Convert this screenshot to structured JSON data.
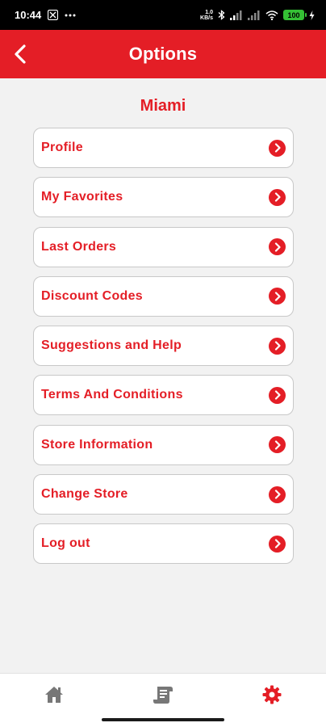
{
  "status_bar": {
    "time": "10:44",
    "net_speed_value": "1.0",
    "net_speed_unit": "KB/s",
    "battery_level": "100"
  },
  "header": {
    "title": "Options"
  },
  "store": {
    "name": "Miami"
  },
  "menu": {
    "items": [
      {
        "label": "Profile"
      },
      {
        "label": "My Favorites"
      },
      {
        "label": "Last Orders"
      },
      {
        "label": "Discount Codes"
      },
      {
        "label": "Suggestions and Help"
      },
      {
        "label": "Terms And Conditions"
      },
      {
        "label": "Store Information"
      },
      {
        "label": "Change Store"
      },
      {
        "label": "Log out"
      }
    ]
  },
  "bottom_nav": {
    "items": [
      {
        "icon": "home-icon",
        "active": false
      },
      {
        "icon": "orders-icon",
        "active": false
      },
      {
        "icon": "settings-icon",
        "active": true
      }
    ]
  },
  "colors": {
    "accent": "#e41e26",
    "background": "#f2f2f2",
    "nav_inactive": "#777777"
  }
}
